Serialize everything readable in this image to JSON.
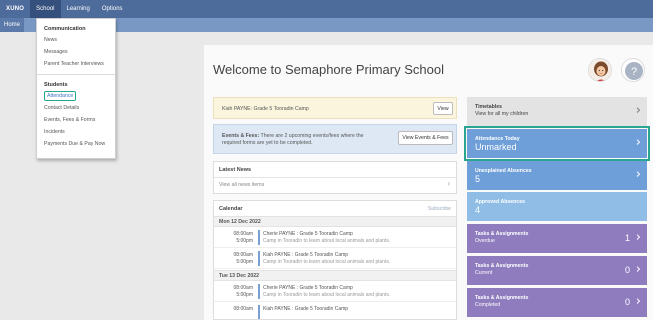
{
  "topbar": {
    "logo": "XUNO",
    "nav": [
      "School",
      "Learning",
      "Options"
    ]
  },
  "subbar": {
    "home": "Home"
  },
  "dropdown": {
    "section1": "Communication",
    "items1": [
      "News",
      "Messages",
      "Parent Teacher Interviews"
    ],
    "section2": "Students",
    "items2": [
      "Attendance",
      "Contact Details",
      "Events, Fees & Forms",
      "Incidents",
      "Payments Due & Pay Now"
    ]
  },
  "welcome": "Welcome to Semaphore Primary School",
  "camp_card": {
    "text": "Kiah PAYNE: Grade 5 Tooradin Camp",
    "button": "View"
  },
  "events_card": {
    "text_bold": "Events & Fees:",
    "text": " There are 2 upcoming events/fees where the required forms are yet to be completed.",
    "button": "View Events & Fees"
  },
  "news": {
    "title": "Latest News",
    "link": "View all news items"
  },
  "calendar": {
    "title": "Calendar",
    "subscribe": "Subscribe",
    "days": [
      {
        "label": "Mon 12 Dec 2022",
        "events": [
          {
            "start": "08:00am",
            "end": "5:00pm",
            "title": "Cherie PAYNE : Grade 5 Tooradin Camp",
            "sub": "Camp in Tooradin to learn about local animals and plants."
          },
          {
            "start": "08:00am",
            "end": "5:00pm",
            "title": "Kiah PAYNE : Grade 5 Tooradin Camp",
            "sub": "Camp in Tooradin to learn about local animals and plants."
          }
        ]
      },
      {
        "label": "Tue 13 Dec 2022",
        "events": [
          {
            "start": "08:00am",
            "end": "5:00pm",
            "title": "Cherie PAYNE : Grade 5 Tooradin Camp",
            "sub": "Camp in Tooradin to learn about local animals and plants."
          },
          {
            "start": "08:00am",
            "end": "",
            "title": "Kiah PAYNE : Grade 5 Tooradin Camp",
            "sub": ""
          }
        ]
      }
    ]
  },
  "tiles": {
    "timetables": {
      "title": "Timetables",
      "sub": "View for all my children"
    },
    "attendance": {
      "title": "Attendance Today",
      "value": "Unmarked"
    },
    "unexplained": {
      "title": "Unexplained Absences",
      "value": "5"
    },
    "approved": {
      "title": "Approved Absences",
      "value": "4"
    },
    "overdue": {
      "title": "Tasks & Assignments",
      "sub": "Overdue",
      "count": "1"
    },
    "current": {
      "title": "Tasks & Assignments",
      "sub": "Current",
      "count": "0"
    },
    "completed": {
      "title": "Tasks & Assignments",
      "sub": "Completed",
      "count": "0"
    }
  },
  "colors": {
    "topbar": "#4d6b9b",
    "highlight_outline": "#2aa58f",
    "tile_blue": "#6f9fd8",
    "tile_purple": "#8e7cbf"
  },
  "icons": [
    "chevron-right-icon",
    "avatar-icon",
    "default-avatar-icon"
  ]
}
